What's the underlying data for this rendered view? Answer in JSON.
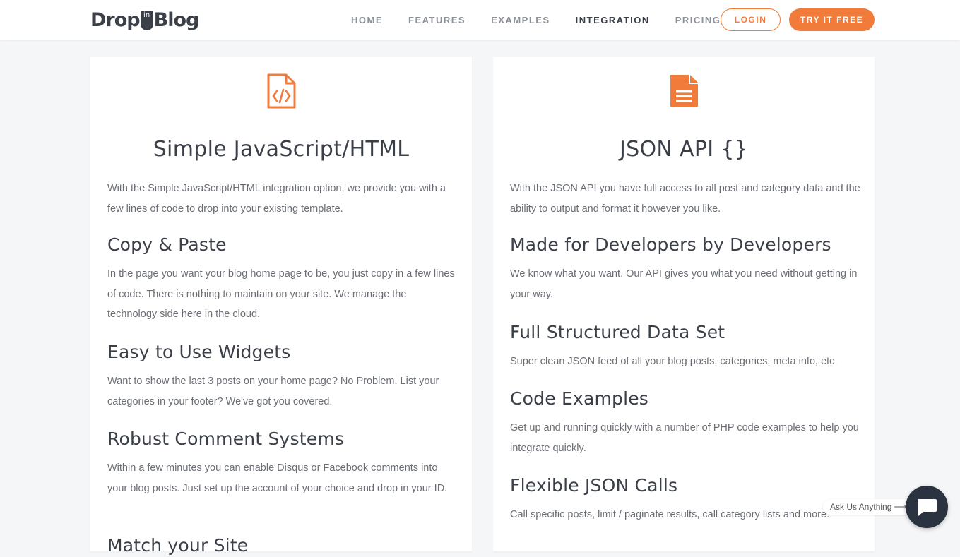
{
  "brand": {
    "logo_left": "Drop",
    "logo_pin": "in",
    "logo_right": "Blog",
    "accent_color": "#f07b3a"
  },
  "nav": {
    "items": [
      {
        "label": "HOME"
      },
      {
        "label": "FEATURES"
      },
      {
        "label": "EXAMPLES"
      },
      {
        "label": "INTEGRATION",
        "active": true
      },
      {
        "label": "PRICING"
      }
    ],
    "login_label": "LOGIN",
    "try_label": "TRY IT FREE"
  },
  "left_card": {
    "icon": "file-code-icon",
    "title": "Simple JavaScript/HTML",
    "intro": "With the Simple JavaScript/HTML integration option, we provide you with a few lines of code to drop into your existing template.",
    "sections": [
      {
        "heading": "Copy & Paste",
        "text": "In the page you want your blog home page to be, you just copy in a few lines of code. There is nothing to maintain on your site. We manage the technology side here in the cloud."
      },
      {
        "heading": "Easy to Use Widgets",
        "text": "Want to show the last 3 posts on your home page? No Problem. List your categories in your footer? We've got you covered."
      },
      {
        "heading": "Robust Comment Systems",
        "text": "Within a few minutes you can enable Disqus or Facebook comments into your blog posts. Just set up the account of your choice and drop in your ID."
      },
      {
        "heading": "Match your Site"
      }
    ]
  },
  "right_card": {
    "icon": "file-text-icon",
    "title": "JSON API {}",
    "intro": "With the JSON API you have full access to all post and category data and the ability to output and format it however you like.",
    "sections": [
      {
        "heading": "Made for Developers by Developers",
        "text": "We know what you want. Our API gives you what you need without getting in your way."
      },
      {
        "heading": "Full Structured Data Set",
        "text": "Super clean JSON feed of all your blog posts, categories, meta info, etc."
      },
      {
        "heading": "Code Examples",
        "text": "Get up and running quickly with a number of PHP code examples to help you integrate quickly."
      },
      {
        "heading": "Flexible JSON Calls",
        "text": "Call specific posts, limit / paginate results, call category lists and more."
      }
    ]
  },
  "chat": {
    "label": "Ask Us Anything",
    "arrow": "⟶",
    "icon": "chat-bubble-icon"
  }
}
